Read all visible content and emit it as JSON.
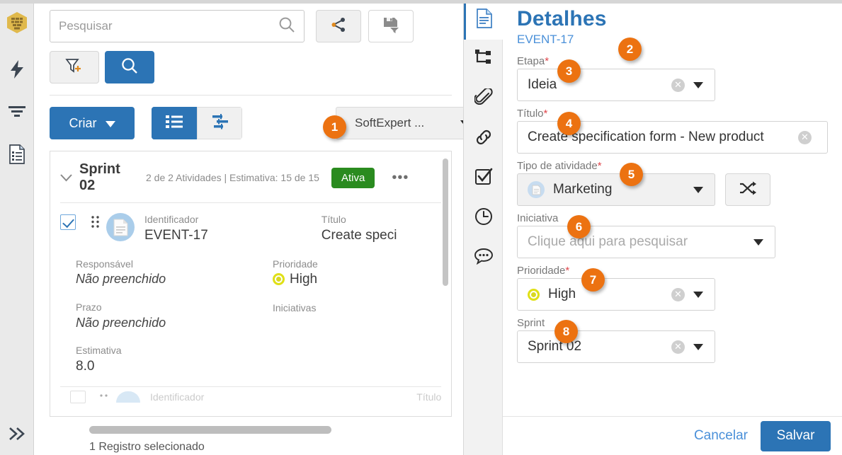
{
  "left_rail": {
    "icons": [
      {
        "name": "app-logo-icon",
        "label": "SoftExpert logo"
      },
      {
        "name": "lightning-icon",
        "label": "Quick actions"
      },
      {
        "name": "filter-lines-icon",
        "label": "Filters"
      },
      {
        "name": "form-document-icon",
        "label": "Records"
      }
    ],
    "expand_label": "»"
  },
  "toolbar": {
    "search_placeholder": "Pesquisar",
    "search_value": "",
    "search_icon": "search-icon",
    "share_icon": "share-icon",
    "save_filter_icon": "save-filter-icon",
    "add_filter_icon": "add-filter-icon",
    "search_button_icon": "search-icon",
    "create_label": "Criar",
    "view_list_icon": "list-view-icon",
    "view_gantt_icon": "gantt-view-icon",
    "project_selected": "SoftExpert ...",
    "callout_1": "1"
  },
  "sprint_card": {
    "chevron": "⌄",
    "name": "Sprint 02",
    "meta": "2 de 2 Atividades | Estimativa: 15 de 15",
    "status_badge": "Ativa",
    "more_menu": "•••",
    "task": {
      "checkbox_checked": true,
      "drag_handle_icon": "drag-handle-icon",
      "avatar_icon": "document-avatar-icon",
      "fields": [
        {
          "label": "Identificador",
          "value": "EVENT-17"
        },
        {
          "label": "Título",
          "value": "Create speci"
        },
        {
          "label": "Responsável",
          "value": "Não preenchido",
          "empty": true
        },
        {
          "label": "Prioridade",
          "value": "High",
          "icon": "priority-high-icon"
        },
        {
          "label": "Prazo",
          "value": "Não preenchido",
          "empty": true
        },
        {
          "label": "Iniciativas",
          "value": ""
        },
        {
          "label": "Estimativa",
          "value": "8.0"
        }
      ]
    },
    "next_row_label_1": "Identificador",
    "next_row_label_2": "Título",
    "status_line": "1 Registro selecionado"
  },
  "right_panel": {
    "tabs": [
      {
        "name": "details-tab",
        "icon": "document-icon",
        "active": true
      },
      {
        "name": "hierarchy-tab",
        "icon": "tree-hierarchy-icon",
        "active": false
      },
      {
        "name": "attachments-tab",
        "icon": "paperclip-icon",
        "active": false
      },
      {
        "name": "links-tab",
        "icon": "link-chain-icon",
        "active": false
      },
      {
        "name": "checklist-tab",
        "icon": "checkbox-check-icon",
        "active": false
      },
      {
        "name": "history-tab",
        "icon": "clock-icon",
        "active": false
      },
      {
        "name": "comments-tab",
        "icon": "comment-bubble-icon",
        "active": false
      }
    ],
    "title": "Detalhes",
    "record_id": "EVENT-17",
    "callouts": {
      "record": "2",
      "etapa": "3",
      "titulo": "4",
      "tipo": "5",
      "iniciativa": "6",
      "prioridade": "7",
      "sprint": "8"
    },
    "fields": {
      "etapa": {
        "label": "Etapa",
        "required": true,
        "value": "Ideia",
        "clearable": true,
        "has_caret": true,
        "muted": false
      },
      "titulo": {
        "label": "Título",
        "required": true,
        "value": "Create specification form - New product",
        "clearable": true,
        "has_caret": false,
        "muted": false
      },
      "tipo_atividade": {
        "label": "Tipo de atividade",
        "required": true,
        "value": "Marketing",
        "clearable": false,
        "has_caret": true,
        "muted": true,
        "icon": "activity-type-icon"
      },
      "iniciativa": {
        "label": "Iniciativa",
        "required": false,
        "value": "",
        "placeholder": "Clique aqui para pesquisar",
        "clearable": false,
        "has_caret": true,
        "muted": false
      },
      "prioridade": {
        "label": "Prioridade",
        "required": true,
        "value": "High",
        "clearable": true,
        "has_caret": true,
        "muted": false,
        "icon": "priority-high-icon"
      },
      "sprint": {
        "label": "Sprint",
        "required": false,
        "value": "Sprint 02",
        "clearable": true,
        "has_caret": true,
        "muted": false
      }
    },
    "shuffle_icon": "shuffle-icon",
    "cancel_label": "Cancelar",
    "save_label": "Salvar"
  },
  "colors": {
    "primary_blue": "#2c74b5",
    "link_blue": "#4a90d9",
    "accent_orange": "#ec7211",
    "status_green": "#2a8b1f",
    "priority_yellow": "#d8d821",
    "required_red": "#e0474c"
  }
}
